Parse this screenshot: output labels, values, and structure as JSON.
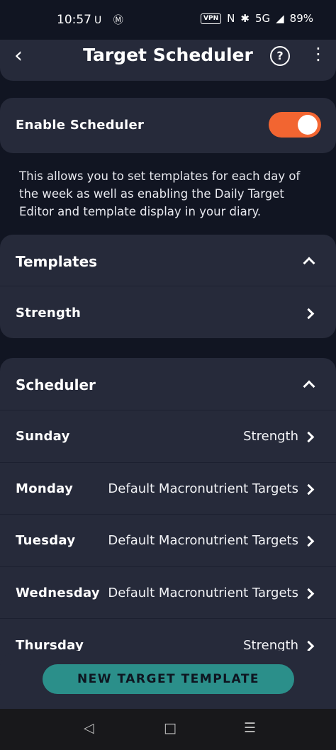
{
  "status_bar": {
    "time": "10:57",
    "left_icons": "ᑌ Ⓜ",
    "vpn": "VPN",
    "network": "5G",
    "battery": "89%"
  },
  "appbar": {
    "title": "Target Scheduler",
    "help_icon": "?",
    "back_icon": "‹",
    "more_icon": "⋮"
  },
  "enable": {
    "label": "Enable Scheduler",
    "toggle_on": true
  },
  "description": "This allows you to set templates for each day of the week as well as enabling the Daily Target Editor and template display in your diary.",
  "templates": {
    "title": "Templates",
    "items": [
      {
        "label": "Strength"
      }
    ]
  },
  "scheduler": {
    "title": "Scheduler",
    "days": [
      {
        "day": "Sunday",
        "value": "Strength"
      },
      {
        "day": "Monday",
        "value": "Default Macronutrient Targets"
      },
      {
        "day": "Tuesday",
        "value": "Default Macronutrient Targets"
      },
      {
        "day": "Wednesday",
        "value": "Default Macronutrient Targets"
      },
      {
        "day": "Thursday",
        "value": "Strength"
      }
    ]
  },
  "button": {
    "label": "NEW TARGET TEMPLATE"
  },
  "nav": {
    "back": "◁",
    "home": "□",
    "menu": "☰"
  }
}
